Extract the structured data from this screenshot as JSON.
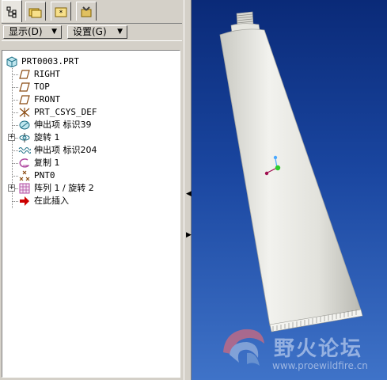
{
  "toolbar": {
    "display_label": "显示(D)",
    "settings_label": "设置(G)"
  },
  "tree": {
    "root": "PRT0003.PRT",
    "items": [
      {
        "label": "RIGHT",
        "icon": "datum-plane-icon"
      },
      {
        "label": "TOP",
        "icon": "datum-plane-icon"
      },
      {
        "label": "FRONT",
        "icon": "datum-plane-icon"
      },
      {
        "label": "PRT_CSYS_DEF",
        "icon": "coordinate-system-icon"
      },
      {
        "label": "伸出项 标识39",
        "icon": "protrusion-icon"
      },
      {
        "label": "旋转 1",
        "icon": "revolve-icon"
      },
      {
        "label": "伸出项 标识204",
        "icon": "protrusion-pattern-icon"
      },
      {
        "label": "复制 1",
        "icon": "copy-feature-icon"
      },
      {
        "label": "PNT0",
        "icon": "datum-point-icon"
      },
      {
        "label": "阵列 1 / 旋转 2",
        "icon": "pattern-icon"
      },
      {
        "label": "在此插入",
        "icon": "insert-here-arrow-icon"
      }
    ]
  },
  "watermark": {
    "title": "野火论坛",
    "url": "www.proewildfire.cn"
  },
  "colors": {
    "viewport_top": "#0a2a78",
    "viewport_bottom": "#3f73c8",
    "model_body": "#e6e6e0",
    "insert_arrow": "#cc0000"
  }
}
